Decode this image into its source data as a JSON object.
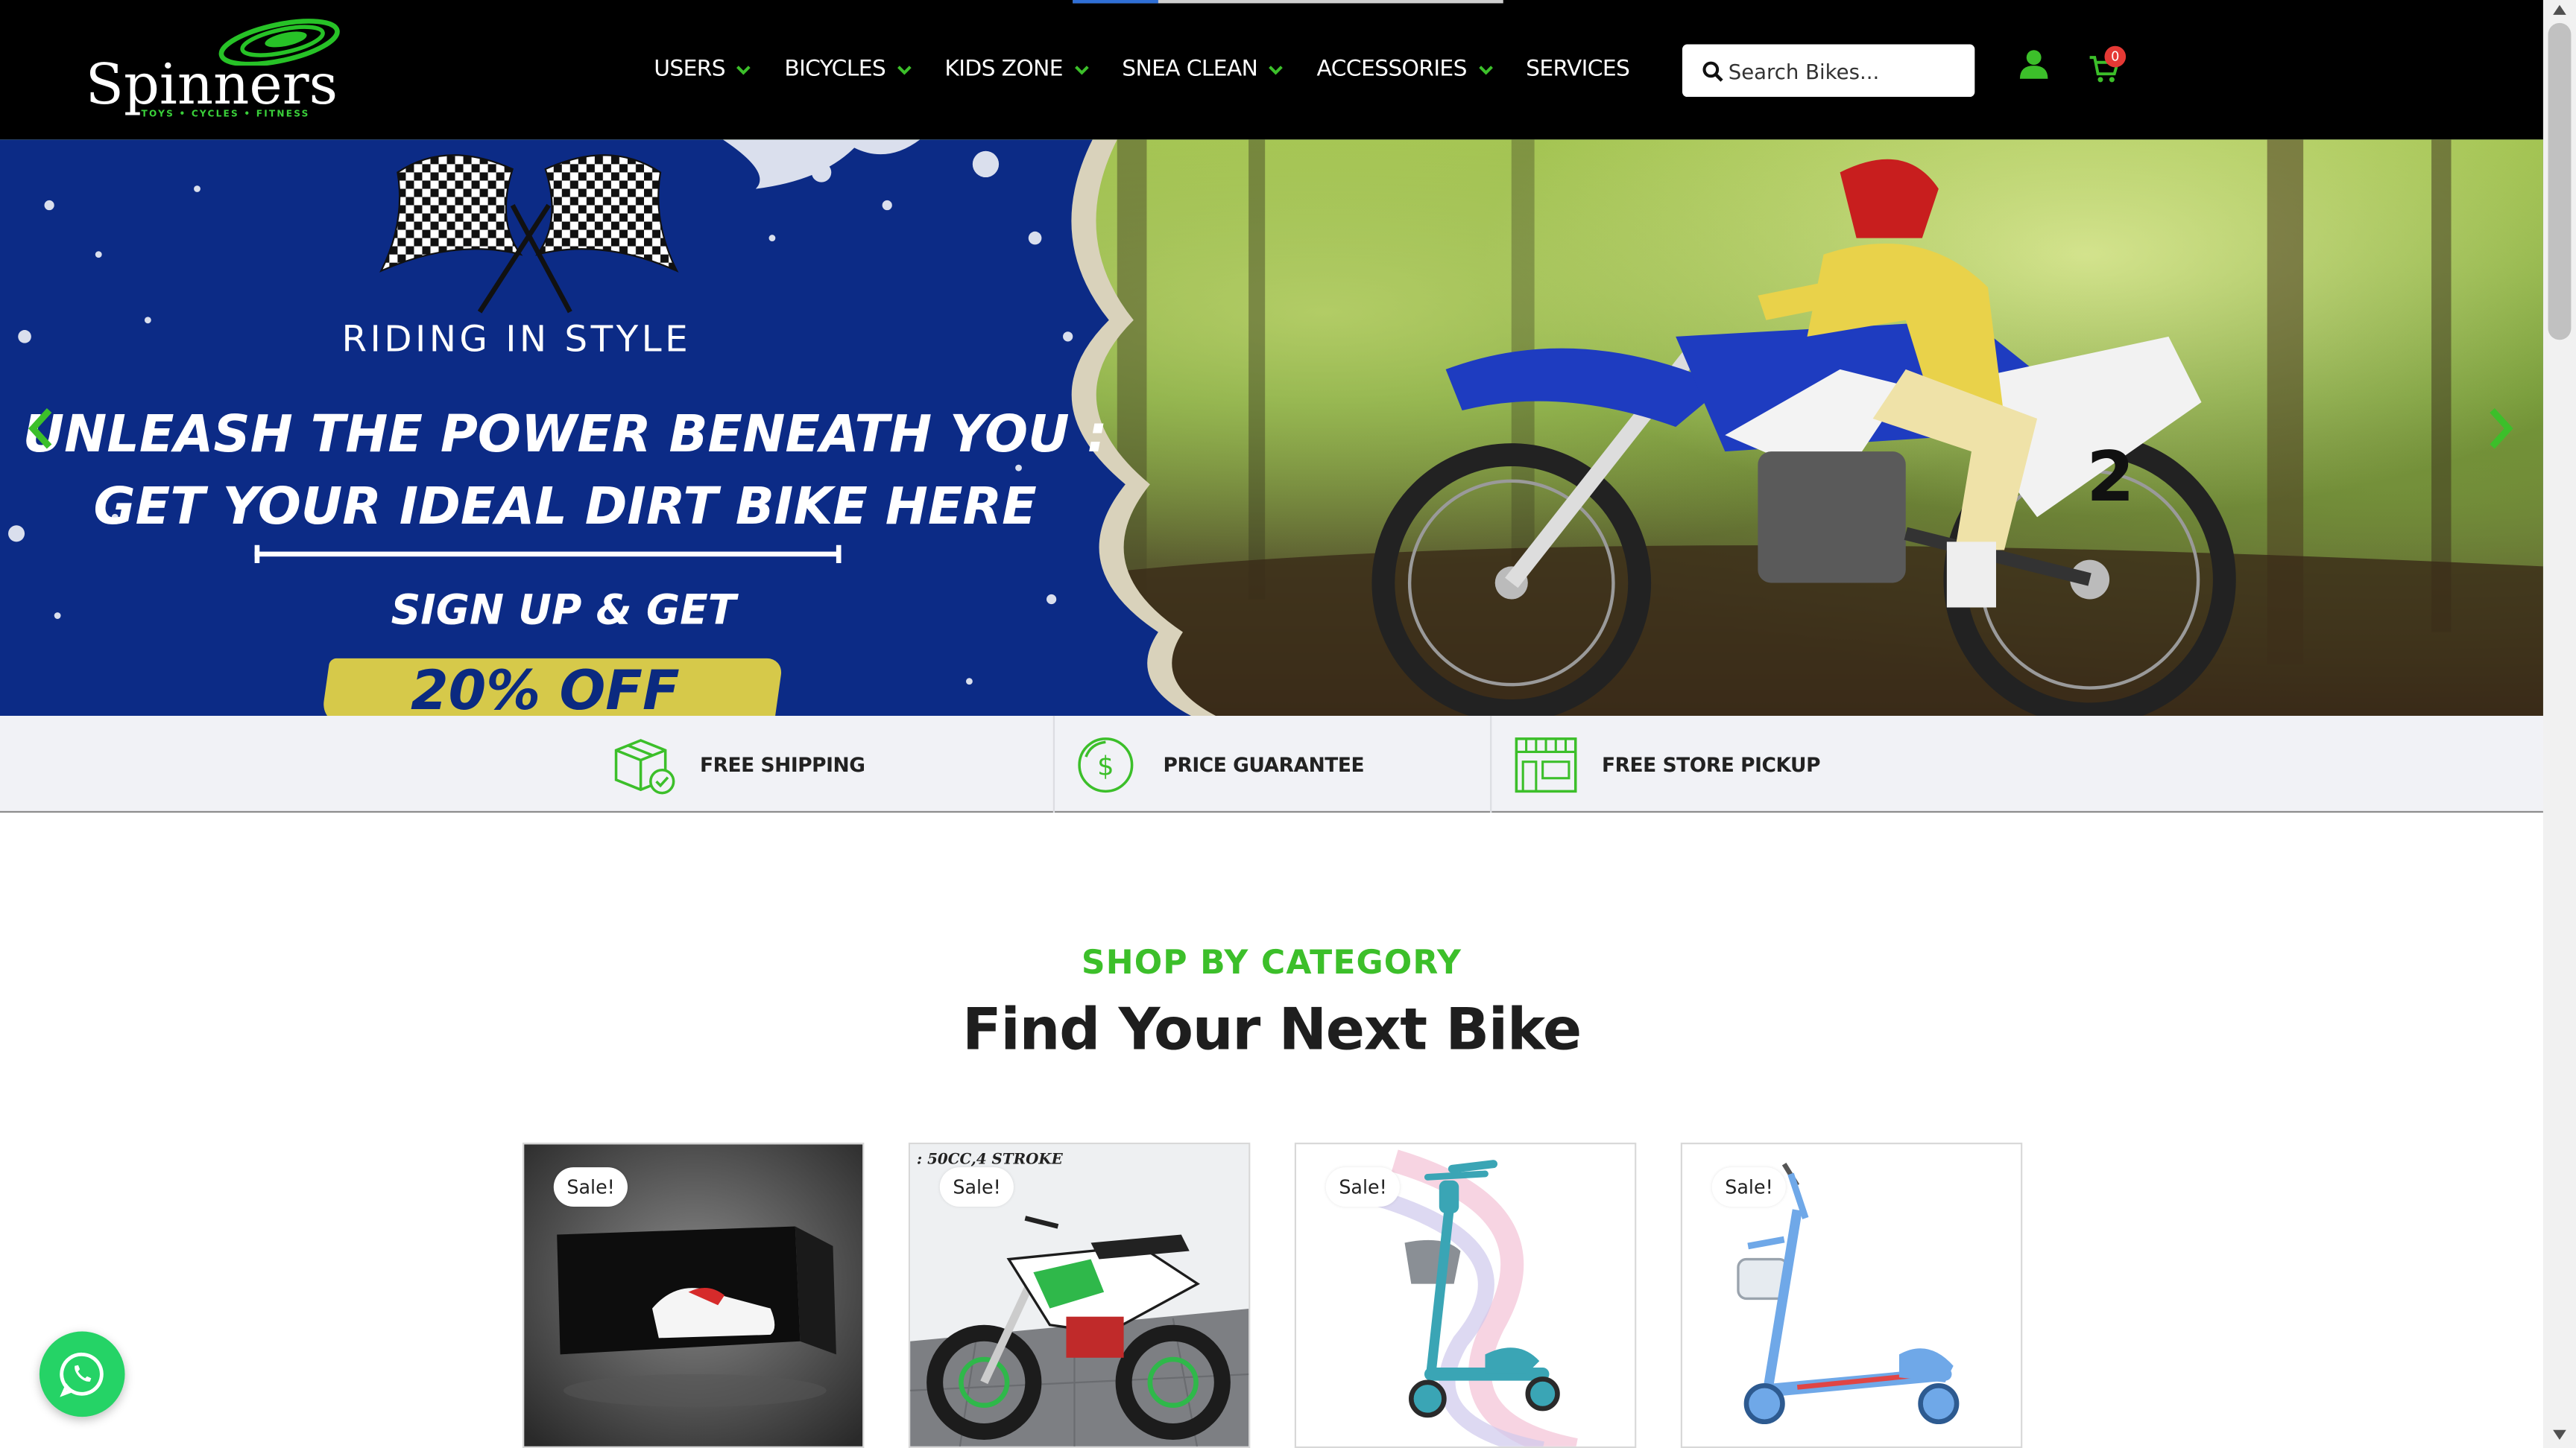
{
  "header": {
    "logo_text": "Spinners",
    "logo_tagline": "TOYS • CYCLES • FITNESS",
    "nav": [
      {
        "label": "USERS",
        "has_dropdown": true
      },
      {
        "label": "BICYCLES",
        "has_dropdown": true
      },
      {
        "label": "KIDS ZONE",
        "has_dropdown": true
      },
      {
        "label": "SNEA CLEAN",
        "has_dropdown": true
      },
      {
        "label": "ACCESSORIES",
        "has_dropdown": true
      },
      {
        "label": "SERVICES",
        "has_dropdown": false
      }
    ],
    "search_placeholder": "Search Bikes...",
    "cart_count": "0",
    "icons": {
      "search": "search-icon",
      "user": "user-icon",
      "cart": "cart-icon",
      "dropdown": "chevron-down-icon"
    }
  },
  "hero": {
    "kicker": "RIDING IN STYLE",
    "line1": "UNLEASH THE POWER BENEATH YOU :",
    "line2": "GET YOUR IDEAL DIRT BIKE HERE",
    "signup": "SIGN UP & GET",
    "offer": "20% OFF",
    "bike_number": "2"
  },
  "features": [
    {
      "label": "FREE SHIPPING",
      "icon": "box-check-icon"
    },
    {
      "label": "PRICE GUARANTEE",
      "icon": "dollar-coin-icon"
    },
    {
      "label": "FREE STORE PICKUP",
      "icon": "storefront-icon"
    }
  ],
  "category": {
    "kicker": "SHOP BY CATEGORY",
    "title": "Find Your Next Bike",
    "cards": [
      {
        "badge": "Sale!",
        "image": "sneaker-box"
      },
      {
        "badge": "Sale!",
        "image": "mini-dirt-bike",
        "overlay_text": ": 50CC,4 STROKE"
      },
      {
        "badge": "Sale!",
        "image": "kids-scooter-teal"
      },
      {
        "badge": "Sale!",
        "image": "kids-scooter-blue"
      }
    ]
  },
  "colors": {
    "accent_green": "#3cbf2a",
    "header_bg": "#000000",
    "hero_blue": "#0b2a80",
    "badge_red": "#e53935"
  }
}
